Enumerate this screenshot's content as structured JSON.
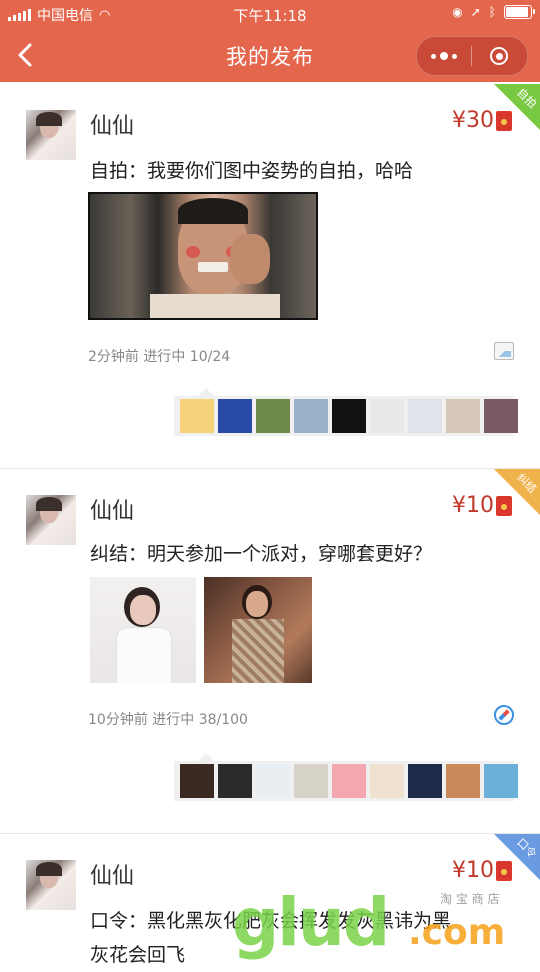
{
  "status": {
    "carrier": "中国电信",
    "time": "下午11:18"
  },
  "nav": {
    "title": "我的发布"
  },
  "posts": [
    {
      "user": "仙仙",
      "price": "¥30",
      "tag": "自拍",
      "tag_color": "#7ac943",
      "text": "自拍：我要你们图中姿势的自拍，哈哈",
      "meta": "2分钟前  进行中  10/24",
      "meta_icon": "image-icon"
    },
    {
      "user": "仙仙",
      "price": "¥10",
      "tag": "纠结",
      "tag_color": "#f0b24a",
      "text": "纠结：明天参加一个派对，穿哪套更好？",
      "meta": "10分钟前  进行中  38/100",
      "meta_icon": "compass-icon"
    },
    {
      "user": "仙仙",
      "price": "¥10",
      "tag": "口令",
      "tag_color": "#6a9be0",
      "text_line1": "口令：黑化黑灰化肥灰会挥发发灰黑讳为黑",
      "text_line2": "灰花会回飞"
    }
  ],
  "watermark": {
    "main": "glud",
    "suffix": ".com",
    "note": "淘 宝 商 店"
  },
  "colors": {
    "accent": "#e4664c",
    "price": "#c0392b"
  }
}
